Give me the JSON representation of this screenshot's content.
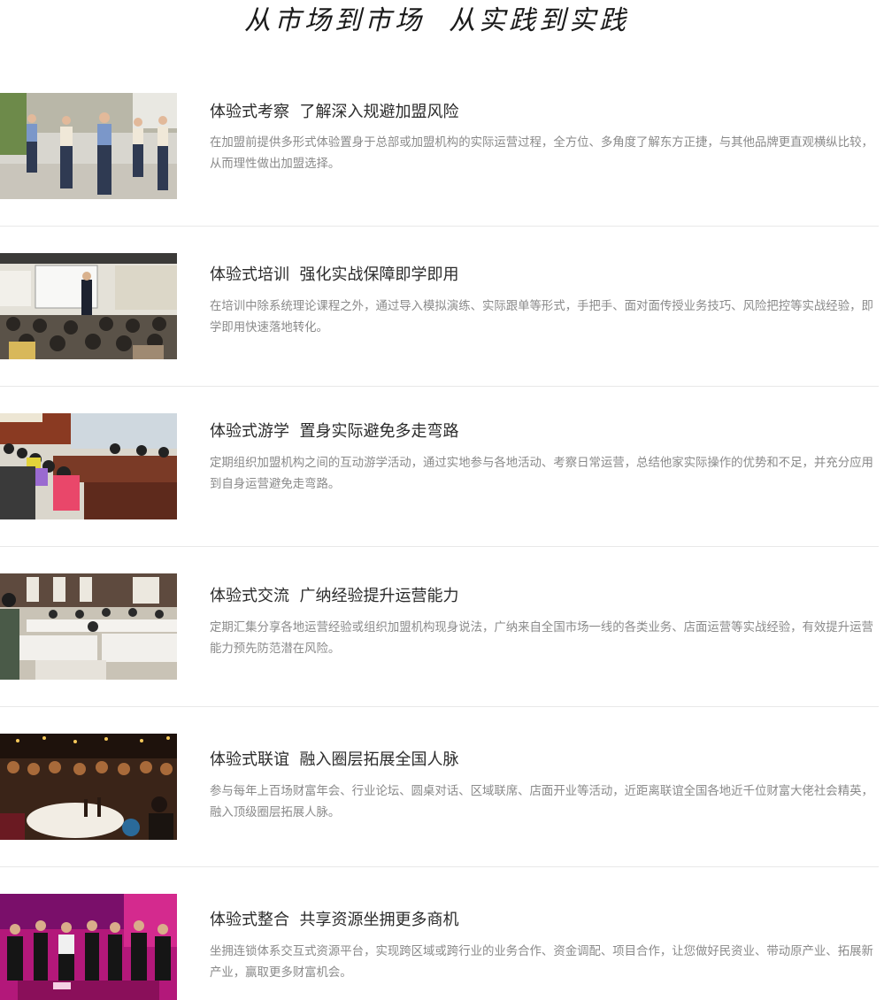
{
  "header": {
    "slogan": "从市场到市场  从实践到实践"
  },
  "items": [
    {
      "title": "体验式考察  了解深入规避加盟风险",
      "desc": "在加盟前提供多形式体验置身于总部或加盟机构的实际运营过程，全方位、多角度了解东方正捷，与其他品牌更直观横纵比较，从而理性做出加盟选择。"
    },
    {
      "title": "体验式培训  强化实战保障即学即用",
      "desc": "在培训中除系统理论课程之外，通过导入模拟演练、实际跟单等形式，手把手、面对面传授业务技巧、风险把控等实战经验，即学即用快速落地转化。"
    },
    {
      "title": "体验式游学  置身实际避免多走弯路",
      "desc": "定期组织加盟机构之间的互动游学活动，通过实地参与各地活动、考察日常运营，总结他家实际操作的优势和不足，并充分应用到自身运营避免走弯路。"
    },
    {
      "title": "体验式交流  广纳经验提升运营能力",
      "desc": "定期汇集分享各地运营经验或组织加盟机构现身说法，广纳来自全国市场一线的各类业务、店面运营等实战经验，有效提升运营能力预先防范潜在风险。"
    },
    {
      "title": "体验式联谊  融入圈层拓展全国人脉",
      "desc": "参与每年上百场财富年会、行业论坛、圆桌对话、区域联席、店面开业等活动，近距离联谊全国各地近千位财富大佬社会精英，融入顶级圈层拓展人脉。"
    },
    {
      "title": "体验式整合  共享资源坐拥更多商机",
      "desc": "坐拥连锁体系交互式资源平台，实现跨区域或跨行业的业务合作、资金调配、项目合作，让您做好民资业、带动原产业、拓展新产业，赢取更多财富机会。"
    }
  ]
}
